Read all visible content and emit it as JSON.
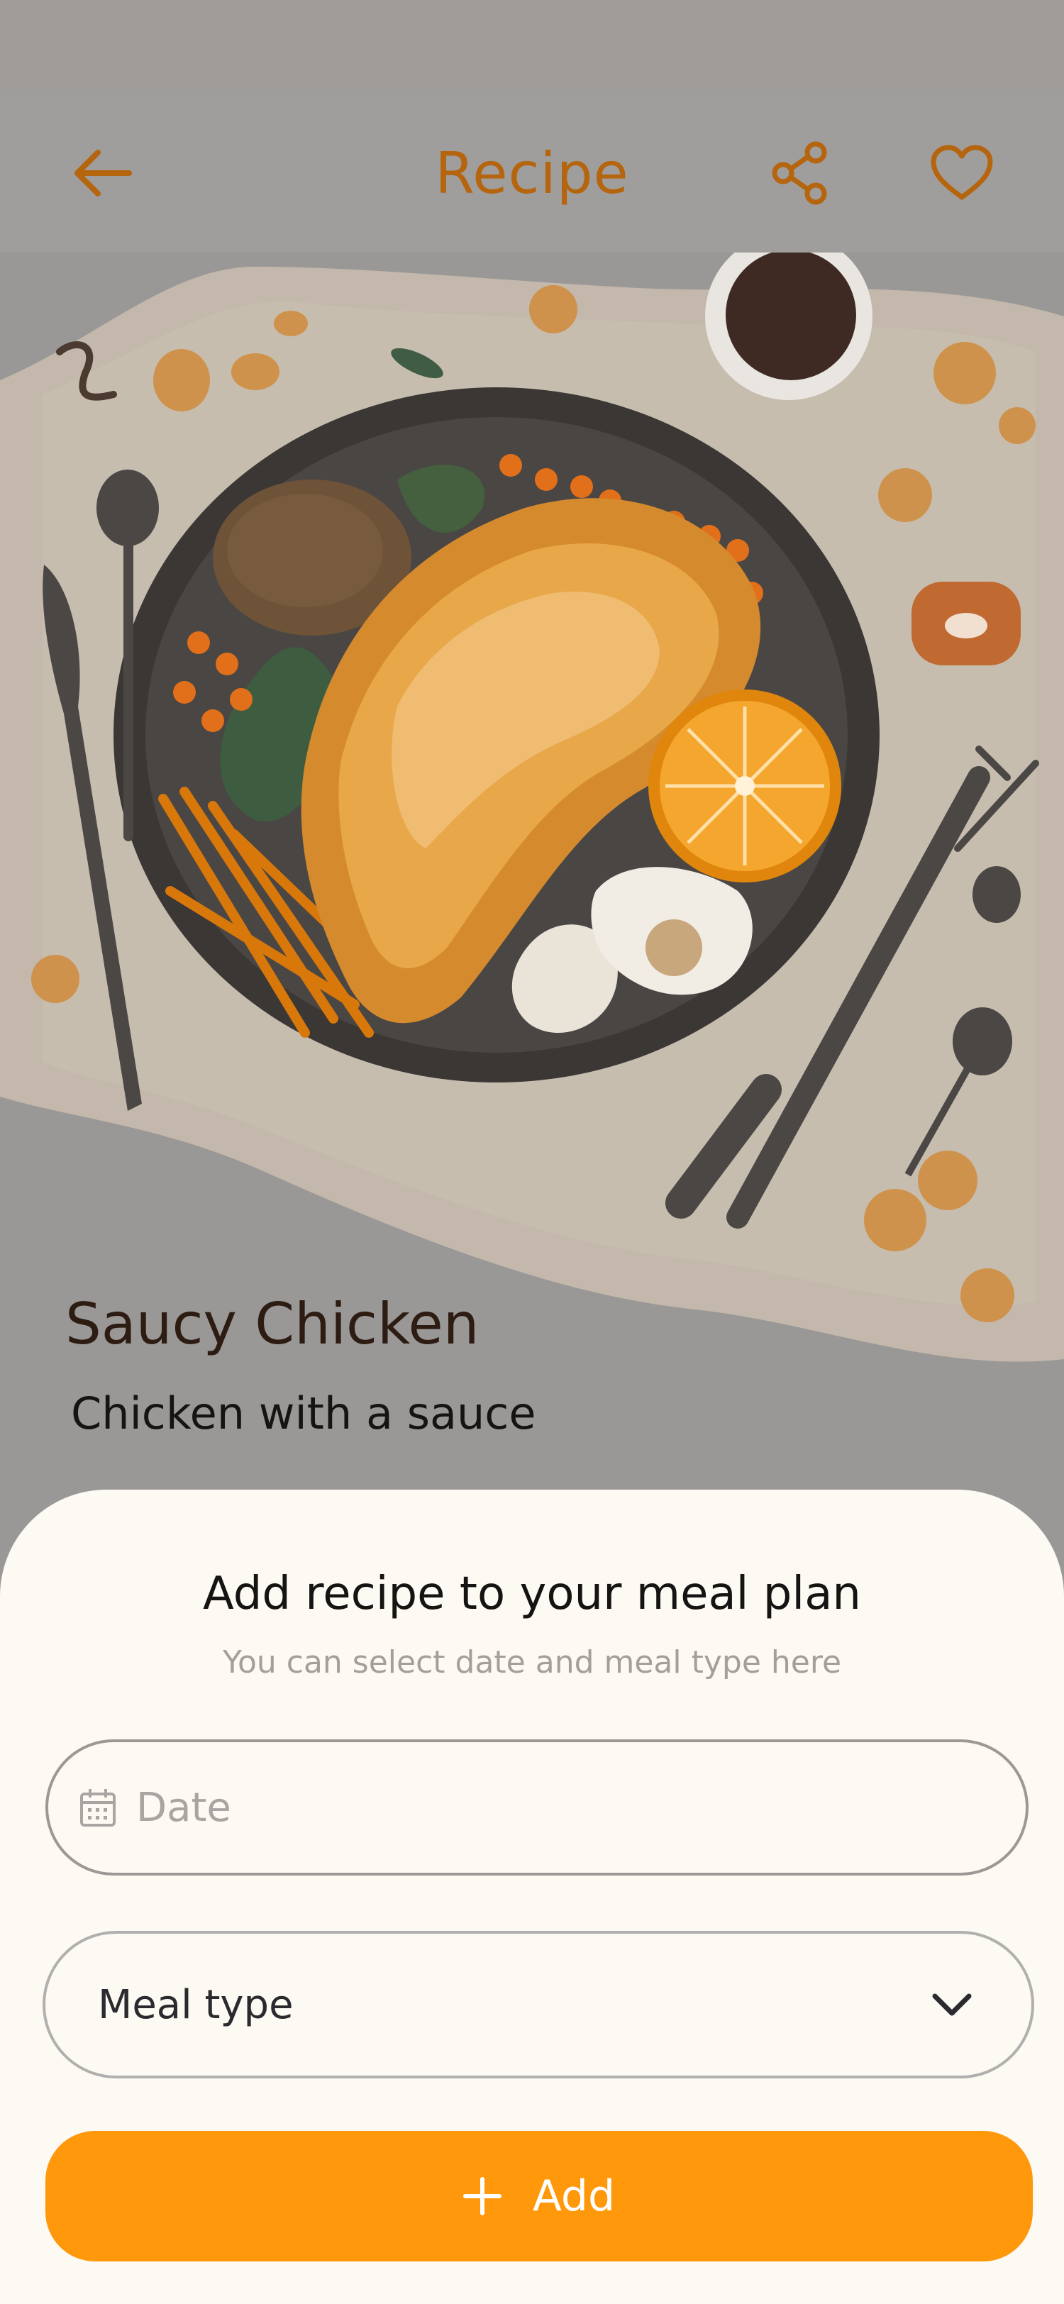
{
  "app_bar": {
    "title": "Recipe",
    "back_icon": "arrow-left-icon",
    "share_icon": "share-icon",
    "favorite_icon": "heart-icon",
    "accent_color": "#b5650e"
  },
  "recipe": {
    "title": "Saucy Chicken",
    "subtitle": "Chicken with a sauce",
    "image": "plated-chicken-with-orange-and-vegetables"
  },
  "sheet": {
    "title": "Add recipe to your meal plan",
    "subtitle": "You can select date and meal type here",
    "date_field": {
      "placeholder": "Date",
      "icon": "calendar-icon"
    },
    "meal_type": {
      "value": "Meal type",
      "icon": "chevron-down-icon"
    },
    "add_button": {
      "label": "Add",
      "icon": "plus-icon",
      "color": "#ff980b"
    }
  }
}
